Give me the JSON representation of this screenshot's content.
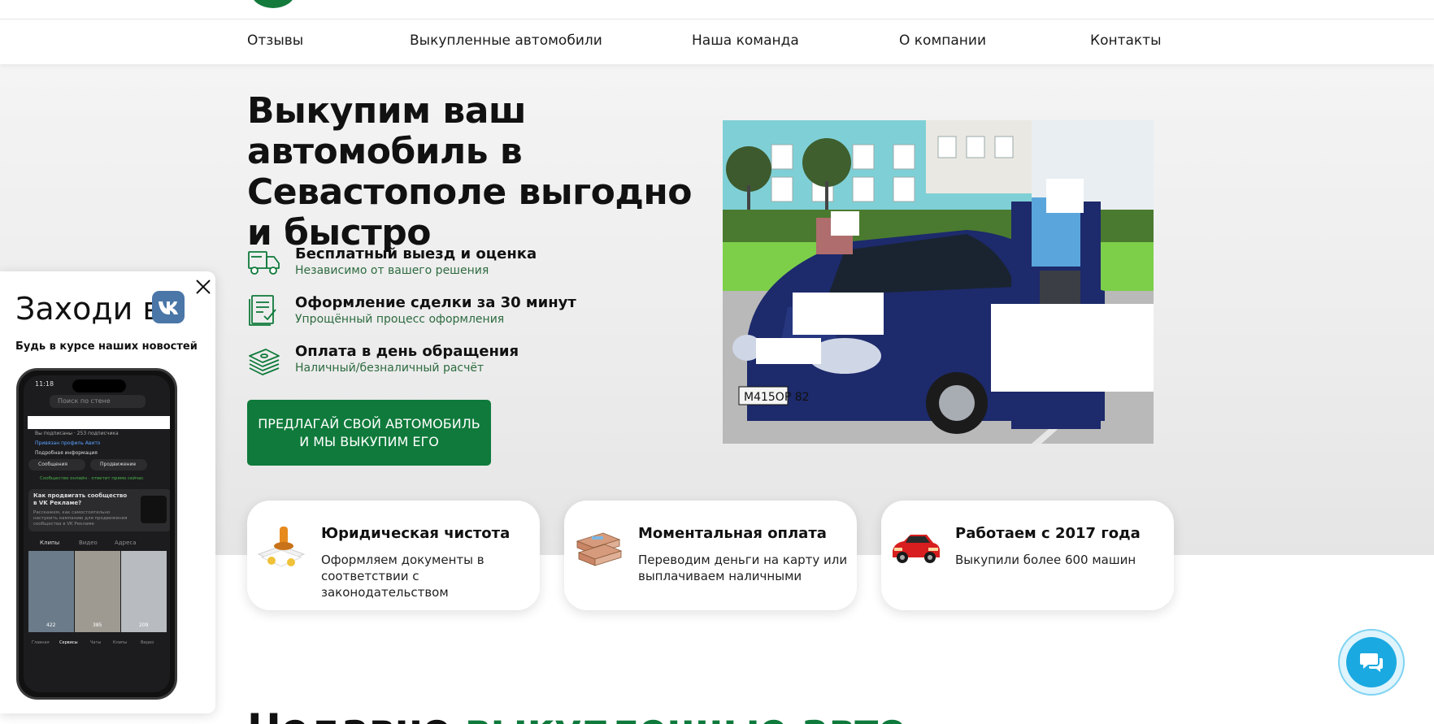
{
  "nav": {
    "items": [
      {
        "label": "Отзывы"
      },
      {
        "label": "Выкупленные автомобили"
      },
      {
        "label": "Наша команда"
      },
      {
        "label": "О компании"
      },
      {
        "label": "Контакты"
      }
    ]
  },
  "hero": {
    "title": "Выкупим ваш автомобиль в Севастополе выгодно и быстро",
    "features": [
      {
        "title": "Бесплатный выезд и оценка",
        "subtitle": "Независимо от вашего решения",
        "icon": "truck-icon"
      },
      {
        "title": "Оформление сделки за 30 минут",
        "subtitle": "Упрощённый процесс оформления",
        "icon": "document-check-icon"
      },
      {
        "title": "Оплата в день обращения",
        "subtitle": "Наличный/безналичный расчёт",
        "icon": "money-stack-icon"
      }
    ],
    "cta_label": "ПРЕДЛАГАЙ СВОЙ АВТОМОБИЛЬ И МЫ ВЫКУПИМ ЕГО",
    "photo": {
      "plate": "М415ОР 82"
    }
  },
  "cards": [
    {
      "title": "Юридическая чистота",
      "text": "Оформляем документы в соответствии с законодательством",
      "icon": "stamp-icon"
    },
    {
      "title": "Моментальная оплата",
      "text": "Переводим деньги на карту или выплачиваем наличными",
      "icon": "cash-icon"
    },
    {
      "title": "Работаем с 2017 года",
      "text": "Выкупили более 600 машин",
      "icon": "red-car-icon"
    }
  ],
  "bottom": {
    "title_part1": "Недавно ",
    "title_part2": "выкупленные авто"
  },
  "vk_popup": {
    "title": "Заходи в",
    "subtitle": "Будь в курсе наших новостей",
    "phone": {
      "time": "11:18",
      "search_placeholder": "Поиск по стене",
      "subscribers": "Вы подписаны · 253 подписчика",
      "avito_link": "Привязан профиль Авито",
      "more_info": "Подробная информация",
      "btn_messages": "Сообщения",
      "btn_promotion": "Продвижение",
      "online": "Сообщество онлайн · ответит прямо сейчас",
      "promo_title": "Как продвигать сообщество в VK Рекламе?",
      "promo_text": "Расскажем, как самостоятельно настроить кампанию для продвижения сообщества в VK Рекламе",
      "tab_clips": "Клипы",
      "tab_video": "Видео",
      "tab_address": "Адреса",
      "counts": [
        "422",
        "385",
        "209"
      ],
      "bottom_nav": [
        "Главная",
        "Сервисы",
        "Чаты",
        "Клипы",
        "Видео"
      ]
    }
  },
  "colors": {
    "brand_green": "#0f7a3b",
    "vk_blue": "#4a76a8",
    "chat_blue": "#1ba9e1"
  }
}
